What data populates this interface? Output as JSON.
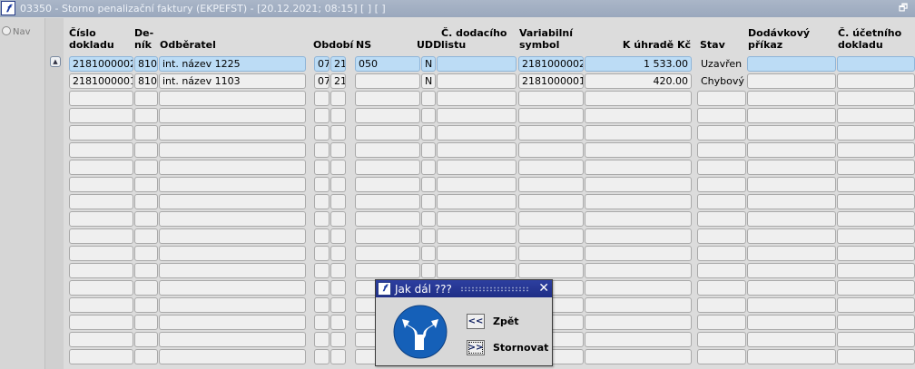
{
  "window": {
    "app_icon": "𝒇",
    "title": "03350 - Storno penalizační faktury (EKPEFST) - [20.12.2021; 08:15]  [ ]  [ ]",
    "restore_glyph": "🗗"
  },
  "nav": {
    "label": "Nav"
  },
  "columns": [
    {
      "key": "cislo",
      "label": "Číslo\ndokladu"
    },
    {
      "key": "denik",
      "label": "De-\nník"
    },
    {
      "key": "odberatel",
      "label": "Odběratel"
    },
    {
      "key": "obdobi",
      "label": "Období"
    },
    {
      "key": "ns",
      "label": "NS"
    },
    {
      "key": "udd",
      "label": "UDD"
    },
    {
      "key": "dodaci",
      "label": "Č. dodacího\nlistu"
    },
    {
      "key": "vs",
      "label": "Variabilní\nsymbol"
    },
    {
      "key": "kuhrade",
      "label": "K úhradě Kč"
    },
    {
      "key": "stav",
      "label": "Stav"
    },
    {
      "key": "dodavkovy",
      "label": "Dodávkový\npříkaz"
    },
    {
      "key": "ucetni",
      "label": "Č. účetního\ndokladu"
    }
  ],
  "rows": [
    {
      "cislo": "2181000002",
      "denik": "810",
      "odberatel": "int. název 1225",
      "obd_m": "07",
      "obd_y": "21",
      "ns": "050",
      "udd": "N",
      "dodaci": "",
      "vs": "2181000002",
      "kuhrade": "1 533.00",
      "stav": "Uzavřen",
      "dodavkovy": "",
      "ucetni": ""
    },
    {
      "cislo": "2181000001",
      "denik": "810",
      "odberatel": "int. název 1103",
      "obd_m": "07",
      "obd_y": "21",
      "ns": "",
      "udd": "N",
      "dodaci": "",
      "vs": "2181000001",
      "kuhrade": "420.00",
      "stav": "Chybový",
      "dodavkovy": "",
      "ucetni": ""
    }
  ],
  "dialog": {
    "title": "Jak dál ???",
    "icon": "fork-direction-sign-icon",
    "buttons": [
      {
        "glyph": "<<",
        "label": "Zpět"
      },
      {
        "glyph": ">>",
        "label": "Stornovat"
      }
    ]
  },
  "colors": {
    "selected_row": "#bcdcf5",
    "dialog_title": "#1f2e86",
    "sign_blue": "#1560b8"
  }
}
